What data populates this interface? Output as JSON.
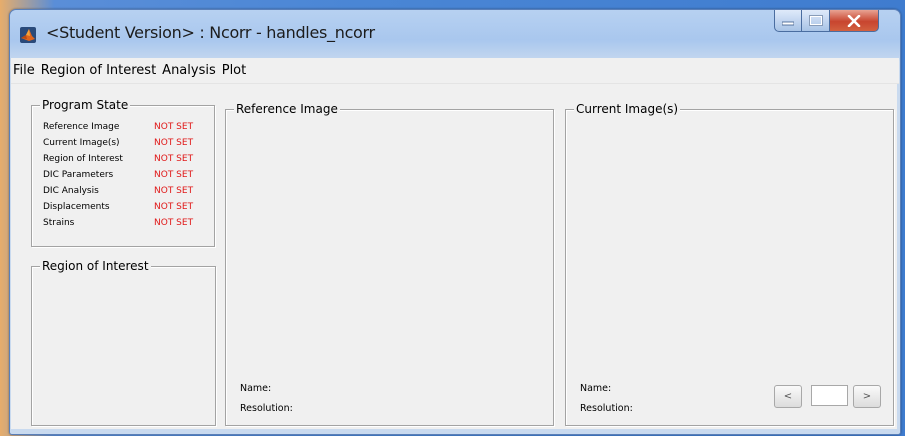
{
  "window": {
    "title": "<Student Version> : Ncorr - handles_ncorr",
    "buttons": {
      "minimize": "minimize-icon",
      "maximize": "maximize-icon",
      "close_label": "X"
    }
  },
  "menu": [
    "File",
    "Region of Interest",
    "Analysis",
    "Plot"
  ],
  "program_state": {
    "title": "Program State",
    "rows": [
      {
        "label": "Reference Image",
        "value": "NOT SET"
      },
      {
        "label": "Current Image(s)",
        "value": "NOT SET"
      },
      {
        "label": "Region of Interest",
        "value": "NOT SET"
      },
      {
        "label": "DIC Parameters",
        "value": "NOT SET"
      },
      {
        "label": "DIC Analysis",
        "value": "NOT SET"
      },
      {
        "label": "Displacements",
        "value": "NOT SET"
      },
      {
        "label": "Strains",
        "value": "NOT SET"
      }
    ],
    "status_color": "#e01818"
  },
  "roi_panel": {
    "title": "Region of Interest"
  },
  "reference_panel": {
    "title": "Reference Image",
    "name_label": "Name:",
    "resolution_label": "Resolution:"
  },
  "current_panel": {
    "title": "Current Image(s)",
    "name_label": "Name:",
    "resolution_label": "Resolution:",
    "prev_label": "<",
    "next_label": ">",
    "index_value": ""
  }
}
